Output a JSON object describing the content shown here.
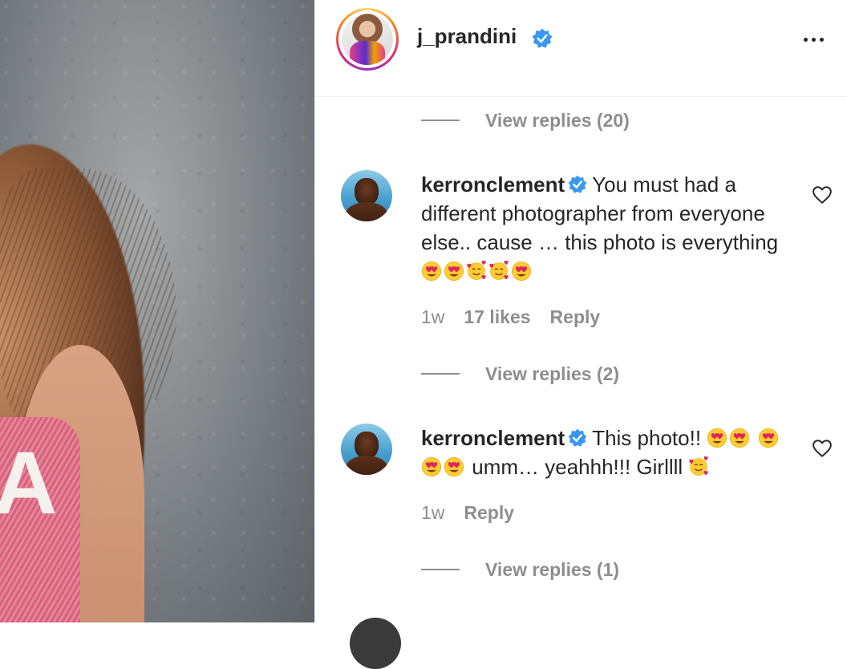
{
  "header": {
    "username": "j_prandini",
    "verified_icon": "verified-badge-icon",
    "more_icon": "more-options-icon"
  },
  "photo": {
    "letter": "A"
  },
  "comments": {
    "replies_top": "View replies (20)",
    "items": [
      {
        "username": "kerronclement",
        "text_before_emoji": "You must had a different photographer from everyone else.. cause … this photo is everything",
        "emoji_sequence": [
          "heart-eyes",
          "heart-eyes",
          "smiling-hearts",
          "smiling-hearts",
          "heart-eyes"
        ],
        "time": "1w",
        "likes": "17 likes",
        "reply_label": "Reply",
        "view_replies": "View replies (2)"
      },
      {
        "username": "kerronclement",
        "text_part1": "This photo!!",
        "text_part2": "umm… yeahhh!!! Girllll",
        "emoji_sequence_1": [
          "heart-eyes",
          "heart-eyes"
        ],
        "emoji_sequence_2": [
          "heart-eyes",
          "heart-eyes",
          "heart-eyes"
        ],
        "emoji_sequence_3": [
          "smiling-hearts"
        ],
        "time": "1w",
        "reply_label": "Reply",
        "view_replies": "View replies (1)"
      }
    ]
  },
  "colors": {
    "text": "#262626",
    "secondary": "#8e8e8e",
    "verified": "#3897f0",
    "divider": "#efefef"
  }
}
